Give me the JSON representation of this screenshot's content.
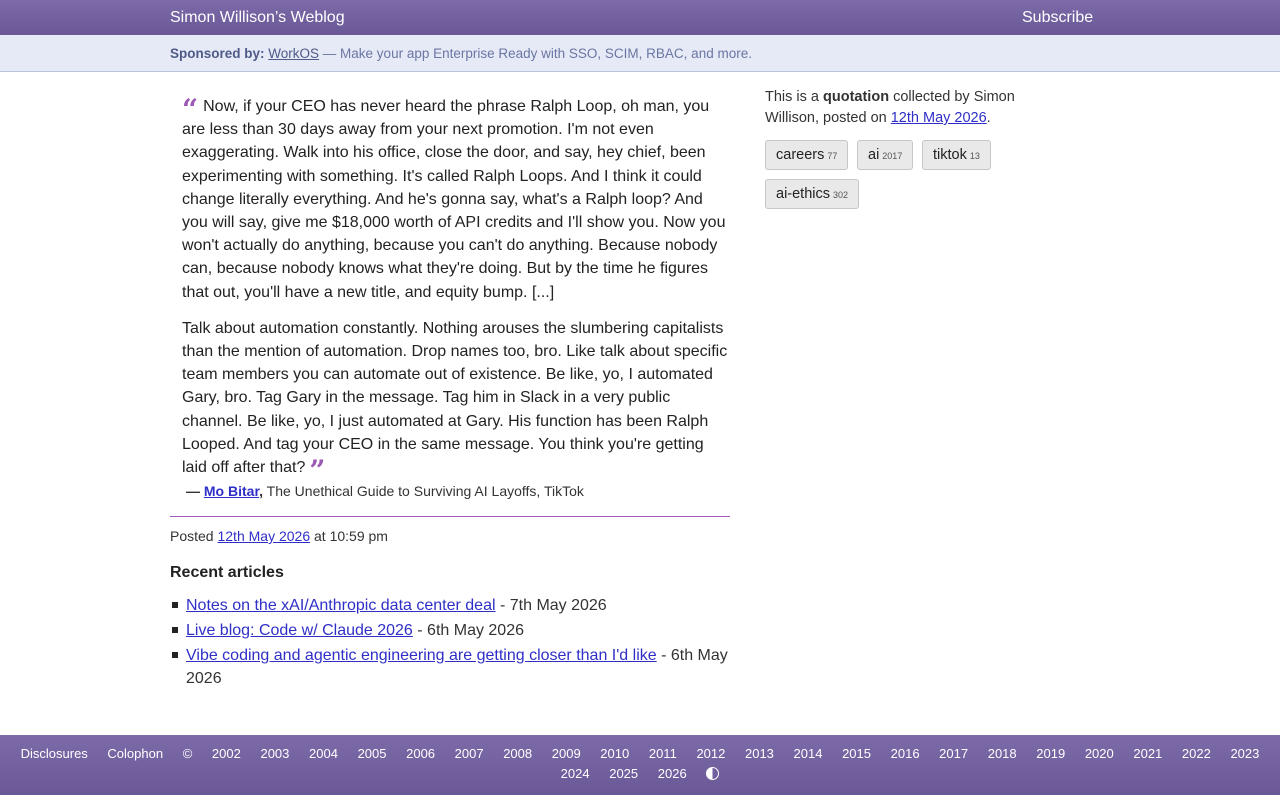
{
  "header": {
    "site_title": "Simon Willison’s Weblog",
    "subscribe": "Subscribe"
  },
  "sponsor": {
    "label": "Sponsored by:",
    "link": "WorkOS",
    "text": " — Make your app Enterprise Ready with SSO, SCIM, RBAC, and more."
  },
  "quote": {
    "open_mark": "“",
    "close_mark": "”",
    "paragraph1": "Now, if your CEO has never heard the phrase Ralph Loop, oh man, you are less than 30 days away from your next promotion. I'm not even exaggerating. Walk into his office, close the door, and say, hey chief, been experimenting with something. It's called Ralph Loops. And I think it could change literally everything. And he's gonna say, what's a Ralph loop? And you will say, give me $18,000 worth of API credits and I'll show you. Now you won't actually do anything, because you can't do anything. Because nobody can, because nobody knows what they're doing. But by the time he figures that out, you'll have a new title, and equity bump. [...]",
    "paragraph2": "Talk about automation constantly. Nothing arouses the slumbering capitalists than the mention of automation. Drop names too, bro. Like talk about specific team members you can automate out of existence. Be like, yo, I automated Gary, bro. Tag Gary in the message. Tag him in Slack in a very public channel. Be like, yo, I just automated at Gary. His function has been Ralph Looped. And tag your CEO in the same message. You think you're getting laid off after that?"
  },
  "citation": {
    "dash": "—",
    "author": "Mo Bitar",
    "comma": ",",
    "source": " The Unethical Guide to Surviving AI Layoffs, TikTok"
  },
  "posted": {
    "prefix": "Posted ",
    "date": "12th May 2026",
    "suffix": " at 10:59 pm"
  },
  "recent": {
    "title": "Recent articles",
    "items": [
      {
        "title": "Notes on the xAI/Anthropic data center deal",
        "date": " - 7th May 2026"
      },
      {
        "title": "Live blog: Code w/ Claude 2026",
        "date": " - 6th May 2026"
      },
      {
        "title": "Vibe coding and agentic engineering are getting closer than I'd like",
        "date": " - 6th May 2026"
      }
    ]
  },
  "sidebar": {
    "text1": "This is a ",
    "kind": "quotation",
    "text2": " collected by Simon Willison, posted on ",
    "date": "12th May 2026",
    "text3": ".",
    "tags": [
      {
        "name": "careers",
        "count": "77"
      },
      {
        "name": "ai",
        "count": "2017"
      },
      {
        "name": "tiktok",
        "count": "13"
      },
      {
        "name": "ai-ethics",
        "count": "302"
      }
    ]
  },
  "footer": {
    "disclosures": "Disclosures",
    "colophon": "Colophon",
    "copyright": "©",
    "years": [
      "2002",
      "2003",
      "2004",
      "2005",
      "2006",
      "2007",
      "2008",
      "2009",
      "2010",
      "2011",
      "2012",
      "2013",
      "2014",
      "2015",
      "2016",
      "2017",
      "2018",
      "2019",
      "2020",
      "2021",
      "2022",
      "2023",
      "2024",
      "2025",
      "2026"
    ]
  }
}
